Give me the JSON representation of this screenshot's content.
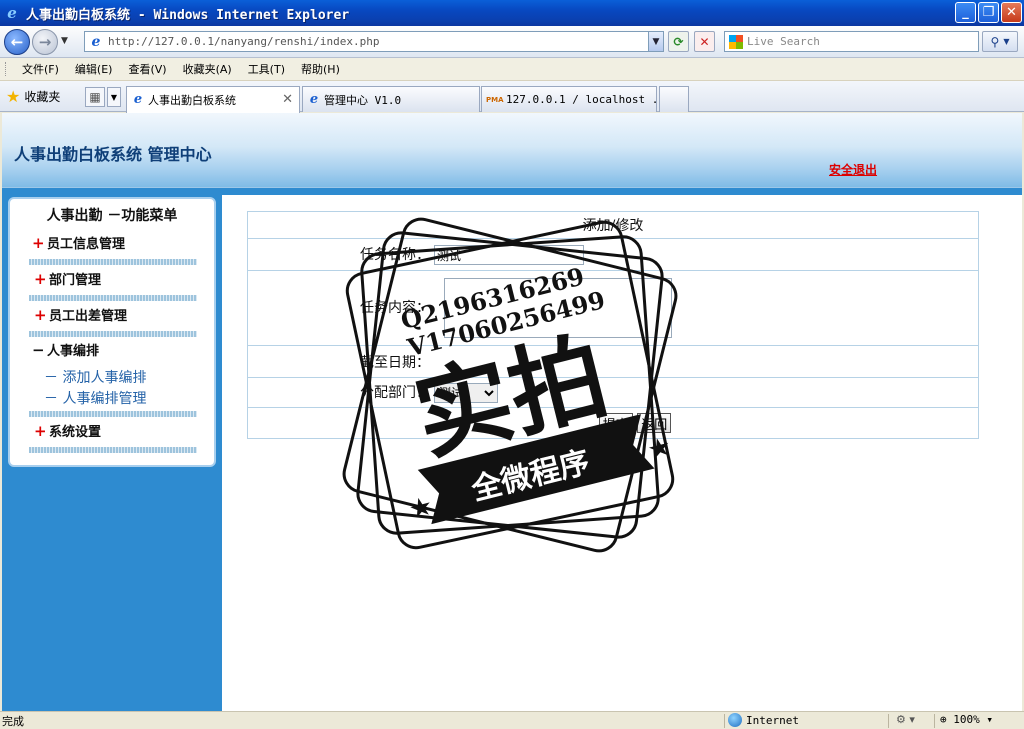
{
  "window": {
    "title": "人事出勤白板系统 - Windows Internet Explorer"
  },
  "navbar": {
    "url": "http://127.0.0.1/nanyang/renshi/index.php",
    "search_placeholder": "Live Search"
  },
  "menubar": {
    "items": [
      "文件(F)",
      "编辑(E)",
      "查看(V)",
      "收藏夹(A)",
      "工具(T)",
      "帮助(H)"
    ]
  },
  "tabs": {
    "favorites": "收藏夹",
    "items": [
      {
        "label": "人事出勤白板系统"
      },
      {
        "label": "管理中心 V1.0"
      },
      {
        "label": "127.0.0.1 / localhost ..."
      }
    ]
  },
  "header": {
    "title": "人事出勤白板系统 管理中心",
    "logout": "安全退出"
  },
  "sidebar": {
    "title": "人事出勤 －功能菜单",
    "sections": [
      {
        "label": "员工信息管理"
      },
      {
        "label": "部门管理"
      },
      {
        "label": "员工出差管理"
      },
      {
        "label": "人事编排"
      },
      {
        "label": "系统设置"
      }
    ],
    "subitems": [
      {
        "label": "－ 添加人事编排"
      },
      {
        "label": "－ 人事编排管理"
      }
    ]
  },
  "form": {
    "heading": "添加/修改",
    "task_name_label": "任务名称：",
    "task_name_value": "测试",
    "task_content_label": "任务内容：",
    "due_date_label": "截至日期：",
    "department_label": "分配部门：",
    "department_value": "测试",
    "submit": "提交",
    "back": "返回"
  },
  "watermark": {
    "qq": "Q2196316269",
    "wechat": "V17060256499",
    "main": "实拍",
    "ribbon": "全微程序"
  },
  "statusbar": {
    "status": "完成",
    "zone": "Internet",
    "zoom": "100%"
  },
  "colors": {
    "title_bar": "#0a48c0",
    "sidebar_bg": "#2e8bd0",
    "logout": "#dd0000",
    "plus": "#dd0000"
  }
}
